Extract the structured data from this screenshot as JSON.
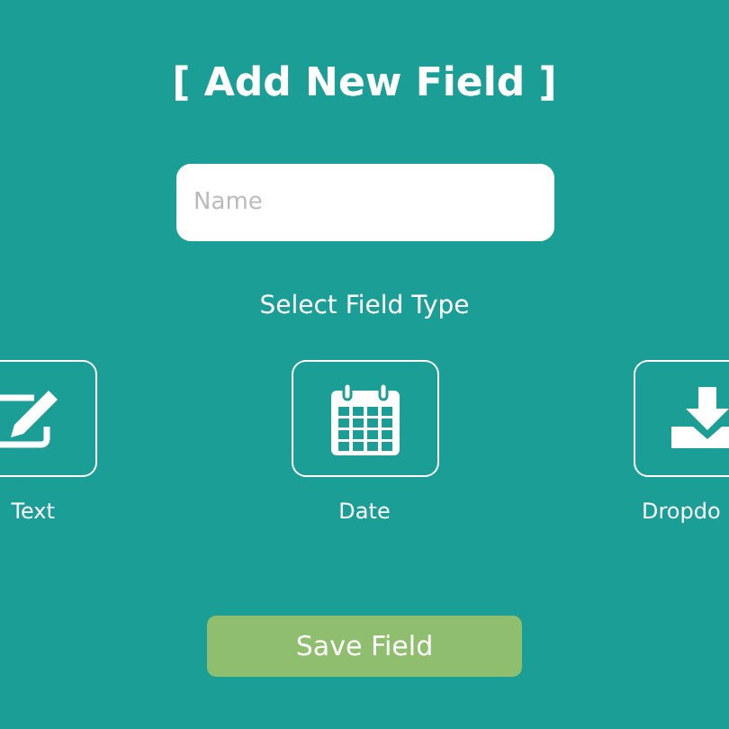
{
  "title": "[ Add New Field ]",
  "name_field": {
    "placeholder": "Name"
  },
  "section_label": "Select Field Type",
  "field_types": [
    {
      "kind": "text",
      "label": "Text"
    },
    {
      "kind": "date",
      "label": "Date"
    },
    {
      "kind": "dropdown",
      "label": "Dropdo"
    }
  ],
  "save_button": "Save Field"
}
